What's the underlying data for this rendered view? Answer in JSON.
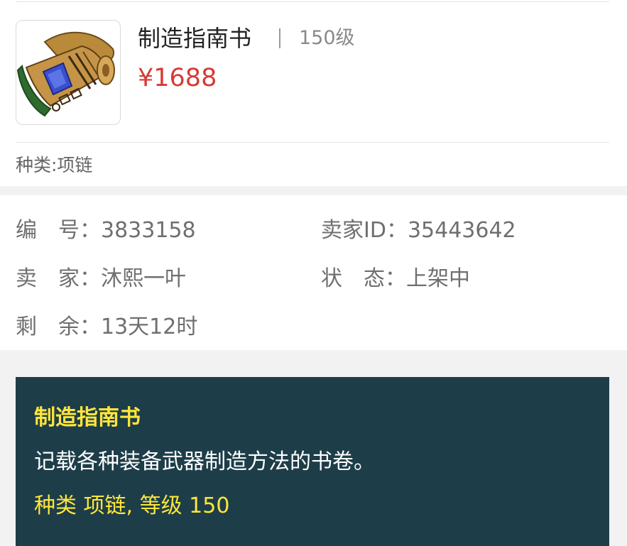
{
  "item": {
    "name": "制造指南书",
    "level": "150级",
    "price": "¥1688",
    "category": "种类:项链",
    "icon": "scroll-icon"
  },
  "details": {
    "id_label": "编",
    "id_label2": "号",
    "id_value": "3833158",
    "seller_id_label": "卖家ID",
    "seller_id_value": "35443642",
    "seller_label": "卖",
    "seller_label2": "家",
    "seller_value": "沐熙一叶",
    "status_label": "状",
    "status_label2": "态",
    "status_value": "上架中",
    "remaining_label": "剩",
    "remaining_label2": "余",
    "remaining_value": "13天12时",
    "colon": "："
  },
  "tooltip": {
    "title": "制造指南书",
    "description": "记载各种装备武器制造方法的书卷。",
    "meta": "种类 项链, 等级 150"
  },
  "colors": {
    "price": "#d83a34",
    "tooltip_bg": "#1d3d49",
    "tooltip_highlight": "#ffe63a"
  }
}
